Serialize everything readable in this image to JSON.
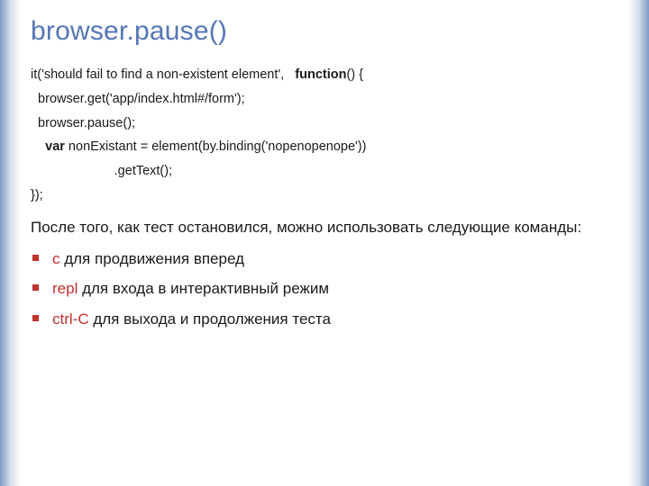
{
  "title": "browser.pause()",
  "code": {
    "l1a": "it('should fail to find a non-existent element',   ",
    "l1b": "function",
    "l1c": "() {",
    "l2": "  browser.get('app/index.html#/form');",
    "l3": "  browser.pause();",
    "l4a": "    ",
    "l4b": "var",
    "l4c": " nonExistant = element(by.binding('nopenopenope'))",
    "l5": "                       .getText();",
    "l6": "});"
  },
  "paragraph": "После того, как тест остановился, можно использовать следующие команды:",
  "items": [
    {
      "cmd": "c",
      "text": " для продвижения вперед"
    },
    {
      "cmd": "repl",
      "text": " для входа в интерактивный режим"
    },
    {
      "cmd": "ctrl-C",
      "text": " для выхода и продолжения теста"
    }
  ]
}
